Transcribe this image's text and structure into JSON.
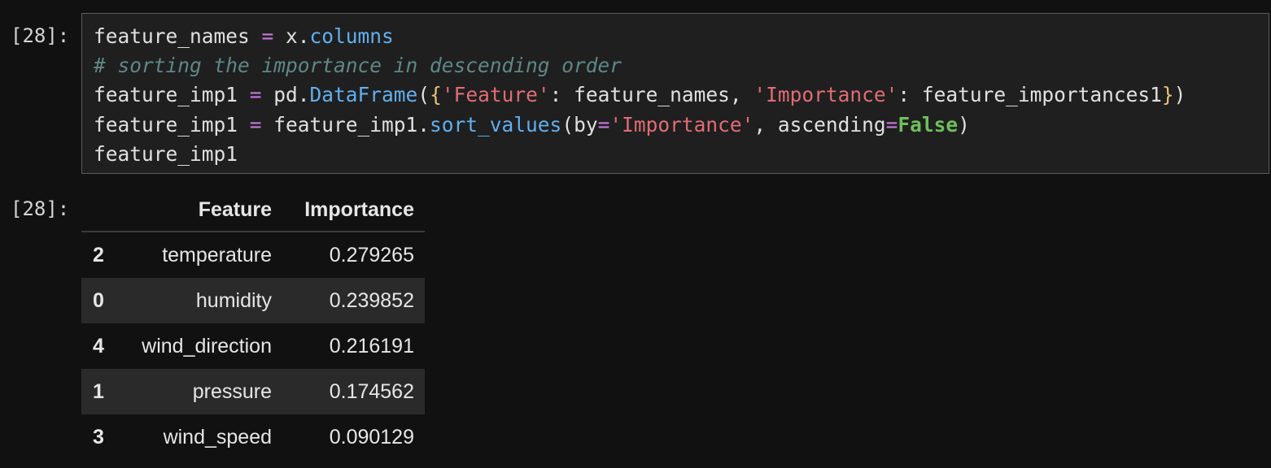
{
  "notebook": {
    "input_prompt": "[28]:",
    "output_prompt": "[28]:"
  },
  "code": {
    "line1": {
      "t1": "feature_names ",
      "t2": "=",
      "t3": " x.",
      "t4": "columns"
    },
    "line2": {
      "comment": "# sorting the importance in descending order"
    },
    "line3": {
      "t1": "feature_imp1 ",
      "t2": "=",
      "t3": " pd.",
      "t4": "DataFrame",
      "t5": "(",
      "t6": "{",
      "t7": "'Feature'",
      "t8": ": feature_names, ",
      "t9": "'Importance'",
      "t10": ": feature_importances1",
      "t11": "}",
      "t12": ")"
    },
    "line4": {
      "t1": "feature_imp1 ",
      "t2": "=",
      "t3": " feature_imp1.",
      "t4": "sort_values",
      "t5": "(by",
      "t6": "=",
      "t7": "'Importance'",
      "t8": ", ascending",
      "t9": "=",
      "t10": "False",
      "t11": ")"
    },
    "line5": {
      "t1": "feature_imp1"
    }
  },
  "table": {
    "headers": {
      "index": "",
      "feature": "Feature",
      "importance": "Importance"
    },
    "rows": [
      {
        "index": "2",
        "feature": "temperature",
        "importance": "0.279265"
      },
      {
        "index": "0",
        "feature": "humidity",
        "importance": "0.239852"
      },
      {
        "index": "4",
        "feature": "wind_direction",
        "importance": "0.216191"
      },
      {
        "index": "1",
        "feature": "pressure",
        "importance": "0.174562"
      },
      {
        "index": "3",
        "feature": "wind_speed",
        "importance": "0.090129"
      }
    ]
  },
  "colors": {
    "background": "#111111",
    "code_background": "#1f1f1f",
    "keyword_operator": "#c678dd",
    "attribute": "#61aff0",
    "string": "#e06c75",
    "comment": "#5f8787",
    "constant": "#6fbf5a"
  }
}
